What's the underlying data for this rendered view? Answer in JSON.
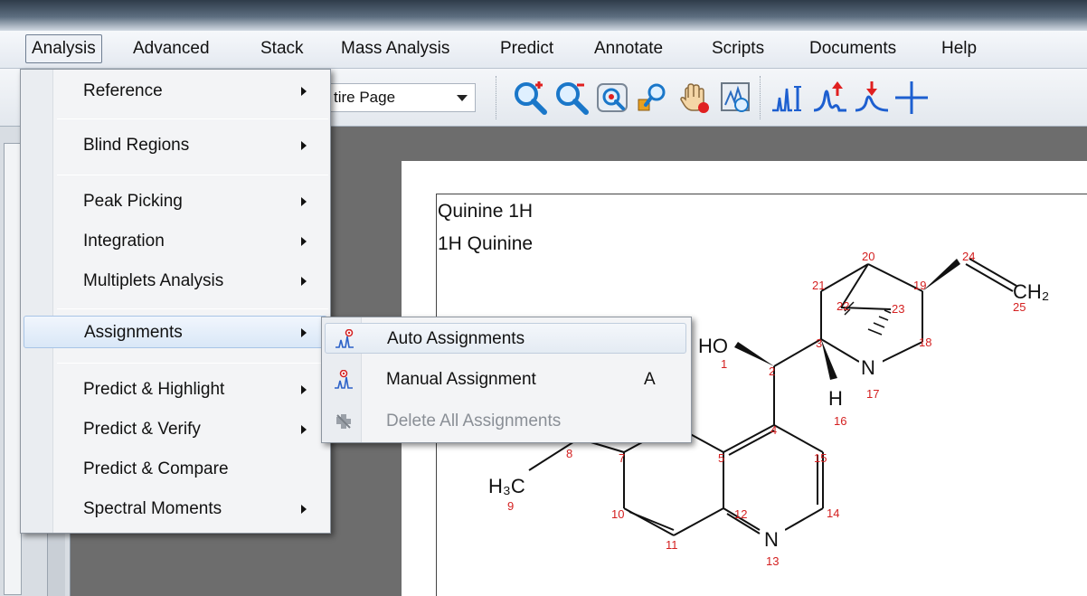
{
  "menubar": {
    "items": [
      "Analysis",
      "Advanced",
      "Stack",
      "Mass Analysis",
      "Predict",
      "Annotate",
      "Scripts",
      "Documents",
      "Help"
    ]
  },
  "toolbar": {
    "zoom_value": "tire Page",
    "icons": [
      "zoom-in-icon",
      "zoom-out-icon",
      "zoom-fit-icon",
      "zoom-region-icon",
      "pan-hand-icon",
      "zoom-image-icon",
      "peak-pick-icon",
      "peak-add-icon",
      "peak-remove-icon",
      "crosshair-icon"
    ]
  },
  "document": {
    "title_line1": "Quinine 1H",
    "title_line2": "1H Quinine"
  },
  "molecule": {
    "labels": {
      "ho": "HO",
      "h": "H",
      "n17": "N",
      "n13": "N",
      "h3c": "H₃C",
      "ch2": "CH₂"
    },
    "atom_numbers": [
      "1",
      "2",
      "3",
      "4",
      "5",
      "7",
      "8",
      "9",
      "10",
      "11",
      "12",
      "13",
      "14",
      "15",
      "16",
      "17",
      "18",
      "19",
      "20",
      "21",
      "22",
      "23",
      "24",
      "25"
    ],
    "number_color": "#d42020"
  },
  "analysis_menu": {
    "items": [
      {
        "label": "Reference",
        "submenu": true
      },
      {
        "label": "Blind Regions",
        "submenu": true
      },
      {
        "label": "Peak Picking",
        "submenu": true
      },
      {
        "label": "Integration",
        "submenu": true
      },
      {
        "label": "Multiplets Analysis",
        "submenu": true
      },
      {
        "label": "Assignments",
        "submenu": true
      },
      {
        "label": "Predict & Highlight",
        "submenu": true
      },
      {
        "label": "Predict & Verify",
        "submenu": true
      },
      {
        "label": "Predict & Compare",
        "submenu": false
      },
      {
        "label": "Spectral Moments",
        "submenu": true
      }
    ]
  },
  "assignments_submenu": {
    "items": [
      {
        "label": "Auto Assignments",
        "shortcut": "",
        "icon": "auto-assign-icon",
        "enabled": true
      },
      {
        "label": "Manual Assignment",
        "shortcut": "A",
        "icon": "manual-assign-icon",
        "enabled": true
      },
      {
        "label": "Delete All Assignments",
        "shortcut": "",
        "icon": "delete-assign-icon",
        "enabled": false
      }
    ]
  }
}
